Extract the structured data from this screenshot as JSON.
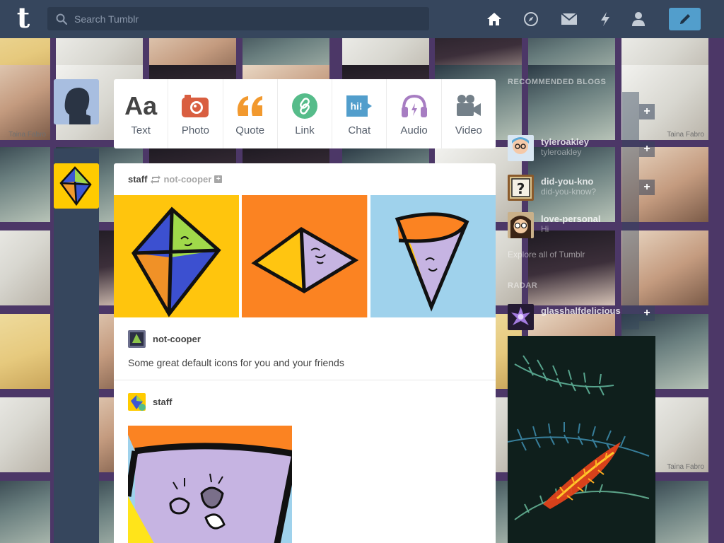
{
  "header": {
    "logo": "t",
    "search_placeholder": "Search Tumblr",
    "nav": [
      "home-icon",
      "explore-icon",
      "messages-icon",
      "activity-icon",
      "account-icon"
    ],
    "compose": "pencil-icon"
  },
  "post_types": [
    {
      "label": "Text",
      "icon": "text-icon",
      "color": "#444444"
    },
    {
      "label": "Photo",
      "icon": "camera-icon",
      "color": "#d95e40"
    },
    {
      "label": "Quote",
      "icon": "quote-icon",
      "color": "#f2992e"
    },
    {
      "label": "Link",
      "icon": "link-icon",
      "color": "#56bc8a"
    },
    {
      "label": "Chat",
      "icon": "chat-icon",
      "color": "#529ecc"
    },
    {
      "label": "Audio",
      "icon": "audio-icon",
      "color": "#a77dc2"
    },
    {
      "label": "Video",
      "icon": "video-icon",
      "color": "#748089"
    }
  ],
  "post": {
    "author": "staff",
    "reblogged_from": "not-cooper",
    "reblog": {
      "name": "not-cooper",
      "text": "Some great default icons for you and your friends"
    },
    "original": {
      "name": "staff"
    }
  },
  "sidebar": {
    "title": "RECOMMENDED BLOGS",
    "blogs": [
      {
        "name": "tyleroakley",
        "sub": "tyleroakley"
      },
      {
        "name": "did-you-kno",
        "sub": "did-you-know?"
      },
      {
        "name": "love-personal",
        "sub": "Hi"
      }
    ],
    "explore": "Explore all of Tumblr",
    "radar_title": "RADAR",
    "radar_blog": {
      "name": "glasshalfdelicious"
    }
  },
  "mosaic": {
    "caption": "Taina Fabro"
  },
  "colors": {
    "header": "#36465d",
    "accent": "#529ecc",
    "background": "#4c3767"
  }
}
